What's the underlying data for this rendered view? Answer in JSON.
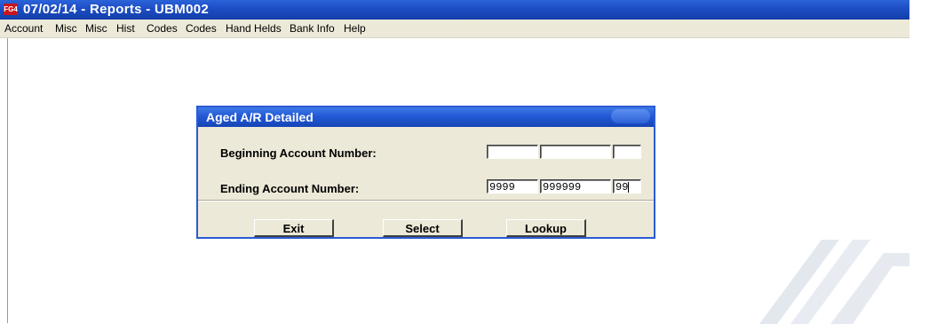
{
  "window": {
    "icon_label": "FG4",
    "title": "07/02/14 - Reports - UBM002"
  },
  "menu": [
    "Account",
    "Misc",
    "Misc",
    "Hist",
    "Codes",
    "Codes",
    "Hand Helds",
    "Bank Info",
    "Help"
  ],
  "dialog": {
    "title": "Aged A/R Detailed",
    "beginning_label": "Beginning Account Number:",
    "ending_label": "Ending Account Number:",
    "beginning_values": [
      "",
      "",
      ""
    ],
    "ending_values": [
      "9999",
      "999999",
      "99"
    ],
    "buttons": {
      "exit": "Exit",
      "select": "Select",
      "lookup": "Lookup"
    }
  },
  "colors": {
    "titlebar": "#1f4fc6",
    "dialog_face": "#ece9d8",
    "app_icon": "#c8161c"
  }
}
